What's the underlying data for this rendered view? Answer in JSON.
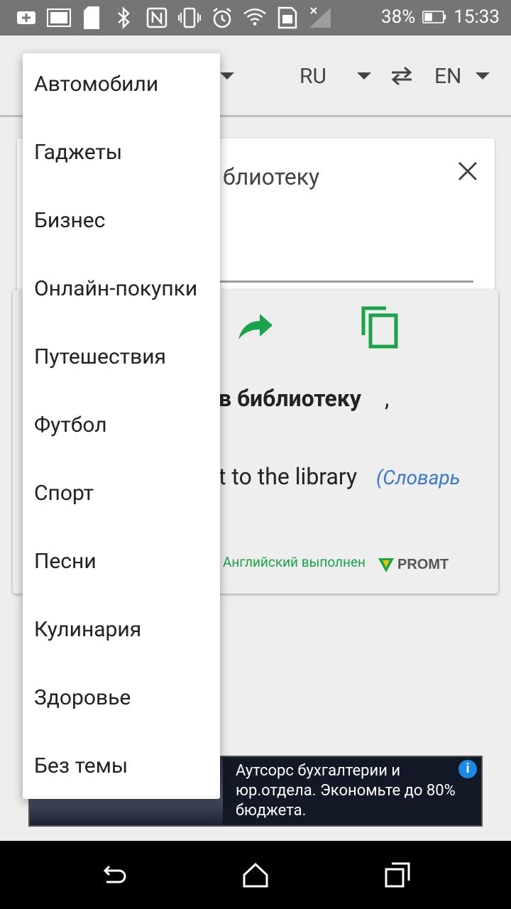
{
  "status_bar": {
    "battery": "38%",
    "time": "15:33"
  },
  "toolbar": {
    "source_lang": "RU",
    "target_lang": "EN"
  },
  "input": {
    "visible_text": "блиотеку"
  },
  "result": {
    "bold_text": "в библиотеку",
    "comma": ",",
    "translation": "t to the library",
    "dictionary_link": "(Словарь",
    "credit": "Английский выполнен",
    "promt_label": "PROMT"
  },
  "ad": {
    "text": "Аутсорс бухгалтерии и юр.отдела. Экономьте до 80% бюджета.",
    "info": "i"
  },
  "menu": {
    "items": [
      "Автомобили",
      "Гаджеты",
      "Бизнес",
      "Онлайн-покупки",
      "Путешествия",
      "Футбол",
      "Спорт",
      "Песни",
      "Кулинария",
      "Здоровье",
      "Без темы"
    ]
  },
  "colors": {
    "accent_green": "#1aa34a",
    "link_blue": "#3a79c8",
    "status_bar": "#757575"
  }
}
